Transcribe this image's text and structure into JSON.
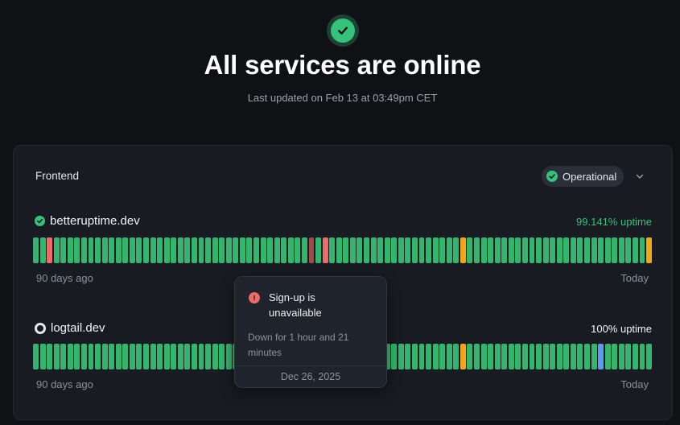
{
  "header": {
    "title": "All services are online",
    "last_updated": "Last updated on Feb 13 at 03:49pm CET"
  },
  "group": {
    "title": "Frontend",
    "status": "Operational"
  },
  "services": [
    {
      "name": "betteruptime.dev",
      "uptime": "99.141% uptime",
      "uptime_color": "#35c27a",
      "start_label": "90 days ago",
      "end_label": "Today",
      "bars": [
        "ok",
        "ok",
        "down",
        "ok",
        "ok",
        "ok",
        "ok",
        "ok",
        "ok",
        "ok",
        "ok",
        "ok",
        "ok",
        "ok",
        "ok",
        "ok",
        "ok",
        "ok",
        "ok",
        "ok",
        "ok",
        "ok",
        "ok",
        "ok",
        "ok",
        "ok",
        "ok",
        "ok",
        "ok",
        "ok",
        "ok",
        "ok",
        "ok",
        "ok",
        "ok",
        "ok",
        "ok",
        "ok",
        "ok",
        "ok",
        "degraded",
        "ok",
        "down",
        "ok",
        "ok",
        "ok",
        "ok",
        "ok",
        "ok",
        "ok",
        "ok",
        "ok",
        "ok",
        "ok",
        "ok",
        "ok",
        "ok",
        "ok",
        "ok",
        "ok",
        "ok",
        "ok",
        "warn",
        "ok",
        "ok",
        "ok",
        "ok",
        "ok",
        "ok",
        "ok",
        "ok",
        "ok",
        "ok",
        "ok",
        "ok",
        "ok",
        "ok",
        "ok",
        "ok",
        "ok",
        "ok",
        "ok",
        "ok",
        "ok",
        "ok",
        "ok",
        "ok",
        "ok",
        "ok",
        "warn"
      ]
    },
    {
      "name": "logtail.dev",
      "uptime": "100% uptime",
      "uptime_color": "#f2f3f5",
      "start_label": "90 days ago",
      "end_label": "Today",
      "bars": [
        "ok",
        "ok",
        "ok",
        "ok",
        "ok",
        "ok",
        "ok",
        "ok",
        "ok",
        "ok",
        "ok",
        "ok",
        "ok",
        "ok",
        "ok",
        "ok",
        "ok",
        "ok",
        "ok",
        "ok",
        "ok",
        "ok",
        "ok",
        "ok",
        "ok",
        "ok",
        "ok",
        "ok",
        "ok",
        "ok",
        "ok",
        "ok",
        "ok",
        "ok",
        "ok",
        "ok",
        "ok",
        "ok",
        "ok",
        "ok",
        "ok",
        "ok",
        "ok",
        "ok",
        "ok",
        "ok",
        "ok",
        "ok",
        "ok",
        "ok",
        "ok",
        "ok",
        "ok",
        "ok",
        "ok",
        "ok",
        "ok",
        "ok",
        "ok",
        "ok",
        "ok",
        "ok",
        "warn",
        "ok",
        "ok",
        "ok",
        "ok",
        "ok",
        "ok",
        "ok",
        "ok",
        "ok",
        "ok",
        "ok",
        "ok",
        "ok",
        "ok",
        "ok",
        "ok",
        "ok",
        "ok",
        "ok",
        "maint",
        "ok",
        "ok",
        "ok",
        "ok",
        "ok",
        "ok",
        "ok"
      ]
    }
  ],
  "tooltip": {
    "title": "Sign-up is unavailable",
    "description": "Down for 1 hour and 21 minutes",
    "date": "Dec 26, 2025"
  }
}
